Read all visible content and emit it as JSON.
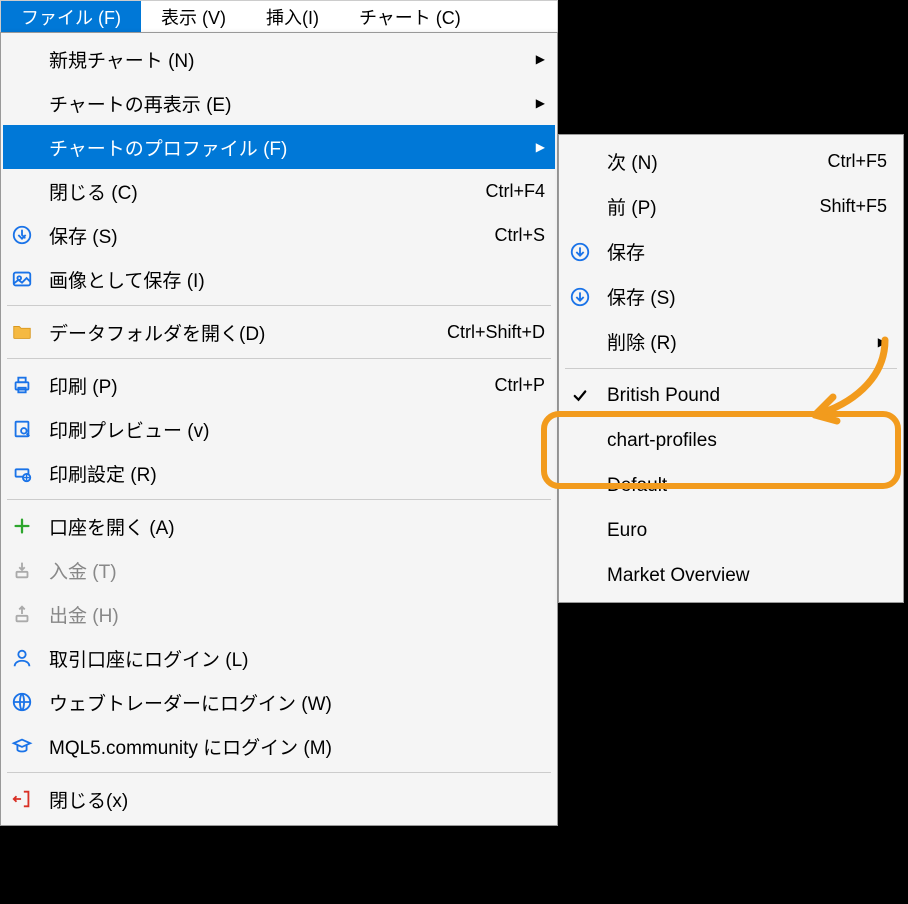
{
  "menubar": {
    "items": [
      {
        "label": "ファイル (F)",
        "active": true
      },
      {
        "label": "表示 (V)"
      },
      {
        "label": "挿入(I)"
      },
      {
        "label": "チャート (C)"
      }
    ]
  },
  "file_menu": {
    "new_chart": "新規チャート (N)",
    "redisplay_chart": "チャートの再表示 (E)",
    "chart_profile": "チャートのプロファイル (F)",
    "close_chart": "閉じる (C)",
    "close_chart_key": "Ctrl+F4",
    "save": "保存 (S)",
    "save_key": "Ctrl+S",
    "save_image": "画像として保存 (I)",
    "open_data_folder": "データフォルダを開く(D)",
    "open_data_folder_key": "Ctrl+Shift+D",
    "print": "印刷 (P)",
    "print_key": "Ctrl+P",
    "print_preview": "印刷プレビュー (v)",
    "print_settings": "印刷設定 (R)",
    "open_account": "口座を開く (A)",
    "deposit": "入金 (T)",
    "withdraw": "出金 (H)",
    "login_trade": "取引口座にログイン (L)",
    "login_web": "ウェブトレーダーにログイン (W)",
    "login_mql5": "MQL5.community にログイン (M)",
    "exit": "閉じる(x)"
  },
  "profile_submenu": {
    "next": "次 (N)",
    "next_key": "Ctrl+F5",
    "prev": "前 (P)",
    "prev_key": "Shift+F5",
    "save": "保存",
    "save_as": "保存 (S)",
    "delete": "削除 (R)",
    "profiles": [
      {
        "name": "British Pound",
        "checked": true
      },
      {
        "name": "chart-profiles",
        "highlighted": true
      },
      {
        "name": "Default"
      },
      {
        "name": "Euro"
      },
      {
        "name": "Market Overview"
      }
    ]
  },
  "icons": {
    "save": "save",
    "image": "image",
    "folder": "folder",
    "printer": "printer",
    "preview": "preview",
    "settings": "settings",
    "plus": "plus",
    "deposit": "deposit",
    "withdraw": "withdraw",
    "user": "user",
    "globe": "globe",
    "graduation": "graduation",
    "exit": "exit"
  }
}
